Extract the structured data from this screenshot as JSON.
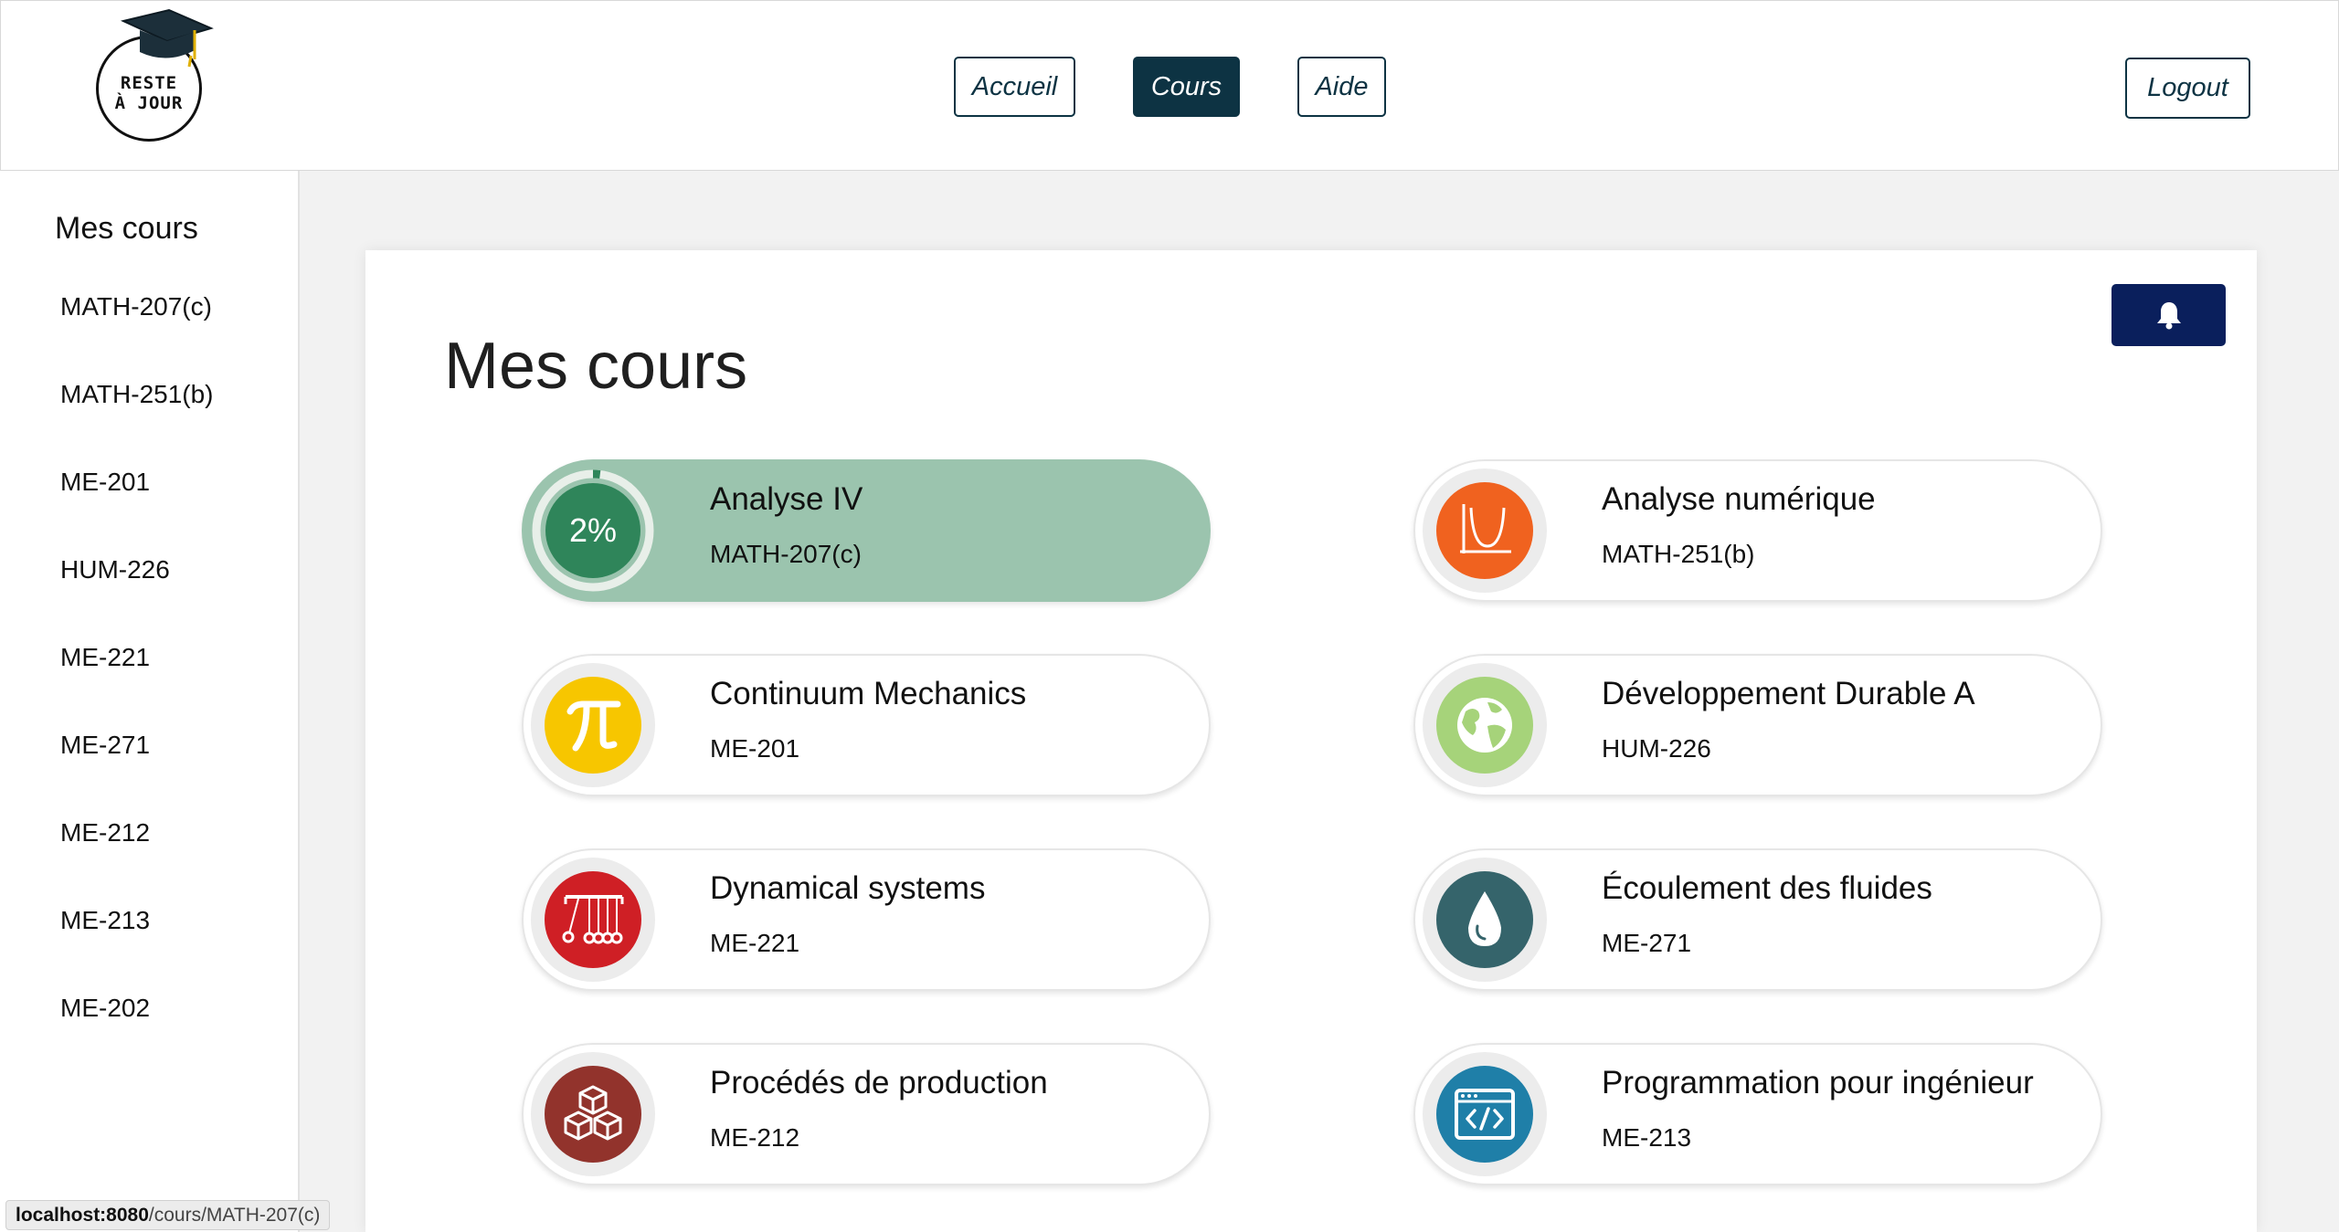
{
  "header": {
    "logo_text_line1": "RESTE",
    "logo_text_line2": "À JOUR",
    "nav": [
      {
        "label": "Accueil",
        "active": false
      },
      {
        "label": "Cours",
        "active": true
      },
      {
        "label": "Aide",
        "active": false
      }
    ],
    "logout_label": "Logout"
  },
  "sidebar": {
    "title": "Mes cours",
    "items": [
      "MATH-207(c)",
      "MATH-251(b)",
      "ME-201",
      "HUM-226",
      "ME-221",
      "ME-271",
      "ME-212",
      "ME-213",
      "ME-202"
    ]
  },
  "main": {
    "title": "Mes cours",
    "bell_icon": "bell-icon",
    "courses": [
      {
        "name": "Analyse IV",
        "code": "MATH-207(c)",
        "progress_label": "2%",
        "progress": 0.02,
        "color": "#2f855a",
        "icon": "progress-ring",
        "active": true
      },
      {
        "name": "Analyse numérique",
        "code": "MATH-251(b)",
        "color": "#f0621f",
        "icon": "parabola-graph-icon"
      },
      {
        "name": "Continuum Mechanics",
        "code": "ME-201",
        "color": "#f7c600",
        "icon": "pi-icon"
      },
      {
        "name": "Développement Durable A",
        "code": "HUM-226",
        "color": "#a6d37a",
        "icon": "globe-icon"
      },
      {
        "name": "Dynamical systems",
        "code": "ME-221",
        "color": "#cf1f25",
        "icon": "newtons-cradle-icon"
      },
      {
        "name": "Écoulement des fluides",
        "code": "ME-271",
        "color": "#35646b",
        "icon": "water-drop-icon"
      },
      {
        "name": "Procédés de production",
        "code": "ME-212",
        "color": "#92332c",
        "icon": "boxes-icon"
      },
      {
        "name": "Programmation pour ingénieur",
        "code": "ME-213",
        "color": "#1f7fa8",
        "icon": "code-window-icon"
      }
    ]
  },
  "statusbar": {
    "host": "localhost:8080",
    "path": "/cours/MATH-207(c)"
  }
}
